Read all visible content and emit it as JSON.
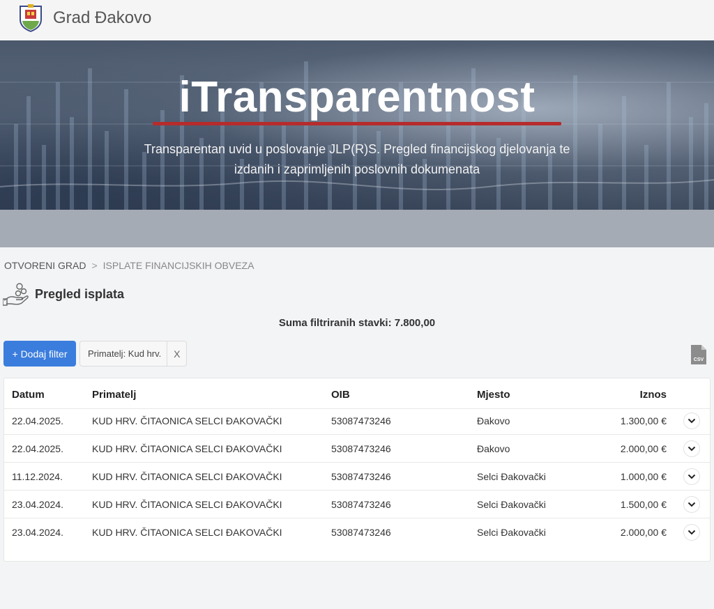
{
  "header": {
    "brand": "Grad Đakovo",
    "logo_icon": "city-coat-of-arms-icon"
  },
  "hero": {
    "title": "iTransparentnost",
    "subtitle_line1": "Transparentan uvid u poslovanje JLP(R)S. Pregled financijskog djelovanja te",
    "subtitle_line2": "izdanih i zaprimljenih poslovnih dokumenata",
    "accent_color": "#b62b2b"
  },
  "breadcrumb": {
    "root": "OTVORENI GRAD",
    "separator": ">",
    "current": "ISPLATE FINANCIJSKIH OBVEZA"
  },
  "section": {
    "title": "Pregled isplata",
    "icon": "hand-coins-icon"
  },
  "summary": {
    "text": "Suma filtriranih stavki: 7.800,00"
  },
  "filters": {
    "add_label": "+ Dodaj filter",
    "chip_text": "Primatelj:  Kud hrv.",
    "chip_remove": "X",
    "export_icon": "csv-file-icon",
    "export_label": "CSV",
    "primary_color": "#3b7ddd"
  },
  "table": {
    "headers": {
      "date": "Datum",
      "recipient": "Primatelj",
      "oib": "OIB",
      "place": "Mjesto",
      "amount": "Iznos"
    },
    "rows": [
      {
        "date": "22.04.2025.",
        "recipient": "KUD HRV. ČITAONICA SELCI ĐAKOVAČKI",
        "oib": "53087473246",
        "place": "Đakovo",
        "amount": "1.300,00 €"
      },
      {
        "date": "22.04.2025.",
        "recipient": "KUD HRV. ČITAONICA SELCI ĐAKOVAČKI",
        "oib": "53087473246",
        "place": "Đakovo",
        "amount": "2.000,00 €"
      },
      {
        "date": "11.12.2024.",
        "recipient": "KUD HRV. ČITAONICA SELCI ĐAKOVAČKI",
        "oib": "53087473246",
        "place": "Selci Đakovački",
        "amount": "1.000,00 €"
      },
      {
        "date": "23.04.2024.",
        "recipient": "KUD HRV. ČITAONICA SELCI ĐAKOVAČKI",
        "oib": "53087473246",
        "place": "Selci Đakovački",
        "amount": "1.500,00 €"
      },
      {
        "date": "23.04.2024.",
        "recipient": "KUD HRV. ČITAONICA SELCI ĐAKOVAČKI",
        "oib": "53087473246",
        "place": "Selci Đakovački",
        "amount": "2.000,00 €"
      }
    ],
    "expand_icon": "chevron-down-icon"
  }
}
